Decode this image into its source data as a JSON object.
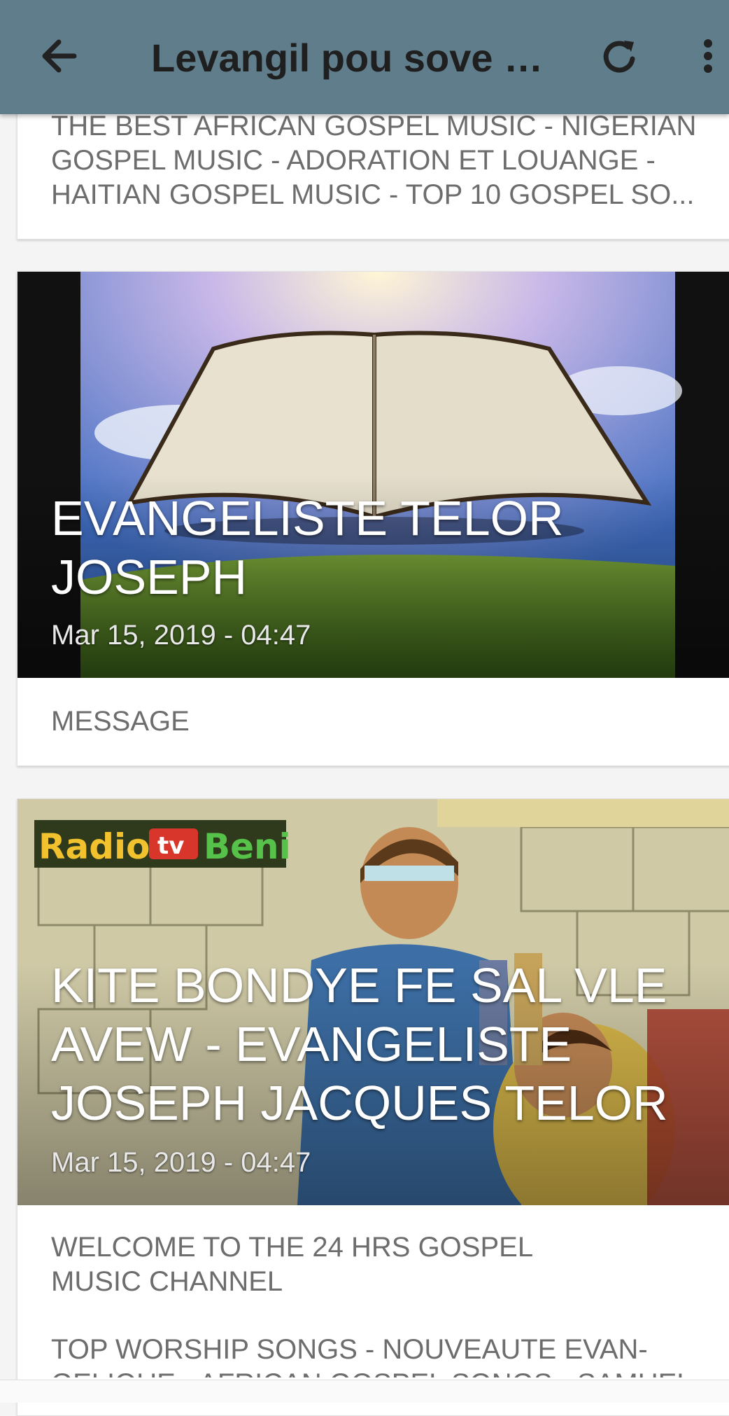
{
  "appbar": {
    "title": "Levangil pou sove n...",
    "back_icon": "arrow-left-icon",
    "refresh_icon": "refresh-icon",
    "more_icon": "more-vert-icon"
  },
  "cards": [
    {
      "description": "THE BEST AFRICAN GOSPEL MUSIC - NIGERIAN GOSPEL MUSIC - ADORATION ET LOUANGE - HAITIAN GOSPEL MUSIC - TOP 10 GOSPEL SO..."
    },
    {
      "title": "EVANGELISTE TELOR JOSEPH",
      "date": "Mar 15, 2019 - 04:47",
      "description": "MESSAGE"
    },
    {
      "logo_text": "Radio tv Beni",
      "title": "KITE BONDYE FE SAL VLE AVEW - EVANGELISTE JOSEPH JACQUES TELOR",
      "date": "Mar 15, 2019 - 04:47",
      "description_1": "WELCOME TO THE 24 HRS GOSPEL MUSIC CHANNEL",
      "description_2": "TOP WORSHIP SONGS  - NOUVEAUTE EVAN- GELIQUE - AFRICAN GOSPEL SONGS - SAMUEL"
    }
  ],
  "colors": {
    "appbar": "#607d8b",
    "card_text": "#6d6d6d",
    "background": "#f4f4f4"
  }
}
